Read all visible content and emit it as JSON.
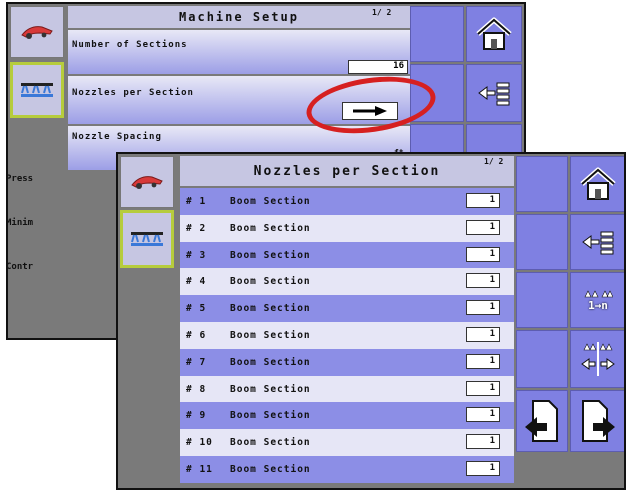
{
  "screen1": {
    "title": "Machine Setup",
    "page": "1/ 2",
    "rows": {
      "number_of_sections": "Number of Sections",
      "number_of_sections_value": "16",
      "nozzles_per_section": "Nozzles per Section",
      "nozzle_spacing": "Nozzle Spacing",
      "nozzle_spacing_partial_unit": "ft",
      "pressure_partial": "Press",
      "minimum_partial": "Minim",
      "control_partial": "Contr"
    },
    "arrow_button_icon": "right-arrow-icon",
    "highlight_color": "#d62020"
  },
  "screen2": {
    "title": "Nozzles per Section",
    "page": "1/ 2",
    "rows": [
      {
        "num": "# 1",
        "label": "Boom Section",
        "value": "1"
      },
      {
        "num": "# 2",
        "label": "Boom Section",
        "value": "1"
      },
      {
        "num": "# 3",
        "label": "Boom Section",
        "value": "1"
      },
      {
        "num": "# 4",
        "label": "Boom Section",
        "value": "1"
      },
      {
        "num": "# 5",
        "label": "Boom Section",
        "value": "1"
      },
      {
        "num": "# 6",
        "label": "Boom Section",
        "value": "1"
      },
      {
        "num": "# 7",
        "label": "Boom Section",
        "value": "1"
      },
      {
        "num": "# 8",
        "label": "Boom Section",
        "value": "1"
      },
      {
        "num": "# 9",
        "label": "Boom Section",
        "value": "1"
      },
      {
        "num": "# 10",
        "label": "Boom Section",
        "value": "1"
      },
      {
        "num": "# 11",
        "label": "Boom Section",
        "value": "1"
      }
    ],
    "side_buttons": {
      "copy_label": "1→n"
    }
  },
  "colors": {
    "accent_blue": "#7f80e2",
    "active_tab_border": "#b6cc3c",
    "background_gray": "#7a7a7a"
  }
}
